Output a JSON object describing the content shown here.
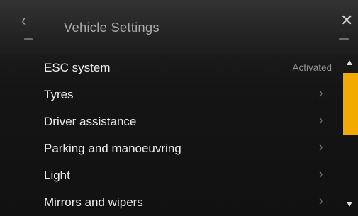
{
  "header": {
    "title": "Vehicle Settings",
    "back_icon": "chevron-left-icon",
    "close_icon": "close-icon"
  },
  "list": {
    "items": [
      {
        "label": "ESC system",
        "value": "Activated"
      },
      {
        "label": "Tyres",
        "chevron": "›"
      },
      {
        "label": "Driver assistance",
        "chevron": "›"
      },
      {
        "label": "Parking and manoeuvring",
        "chevron": "›"
      },
      {
        "label": "Light",
        "chevron": "›"
      },
      {
        "label": "Mirrors and wipers",
        "chevron": "›"
      }
    ]
  },
  "scrollbar": {
    "thumb_color": "#f2a900",
    "position_fraction": 0.0
  },
  "colors": {
    "background": "#151515",
    "accent": "#f2a900"
  }
}
